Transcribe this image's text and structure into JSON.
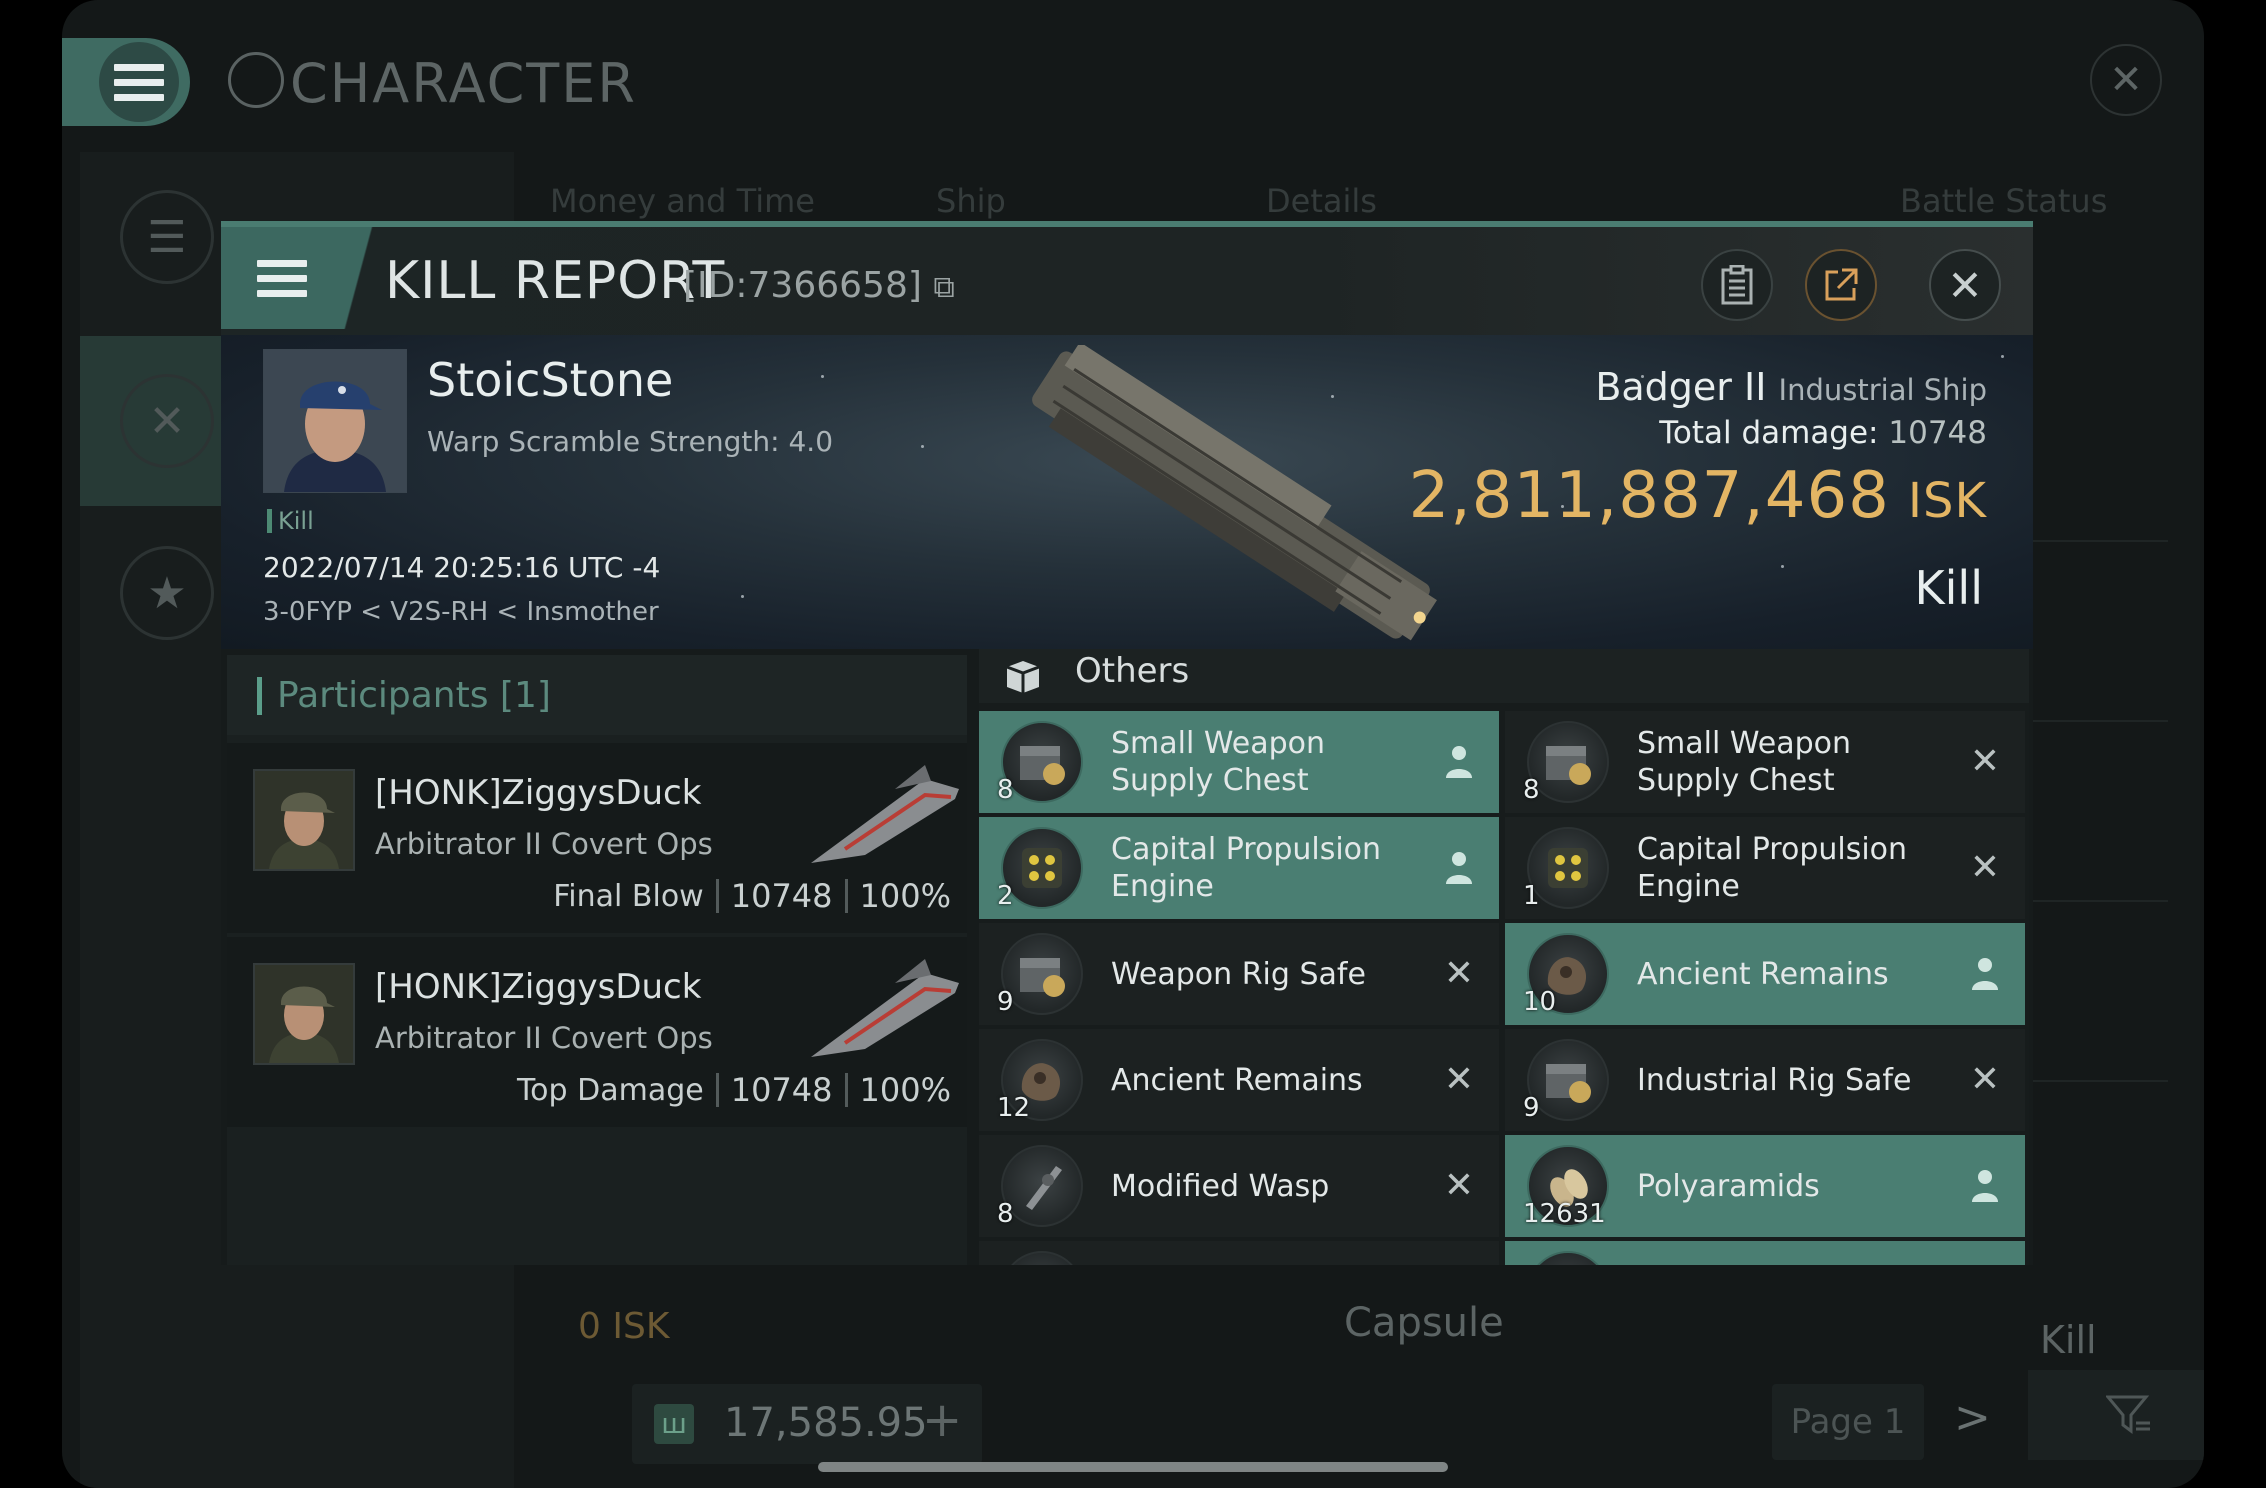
{
  "background_window": {
    "title": "CHARACTER",
    "tabs": [
      "Money and Time",
      "Ship",
      "Details",
      "Battle Status"
    ],
    "bottom_row": {
      "value": "0 ISK",
      "ship": "Capsule",
      "result": "Kill"
    },
    "wallet": {
      "value": "17,585.95",
      "add_label": "+"
    },
    "pagination": {
      "page_label": "Page 1",
      "next_label": ">"
    }
  },
  "kill_report": {
    "title": "KILL REPORT",
    "id_label": "[ID:7366658]",
    "victim": {
      "name": "StoicStone",
      "warp_scramble": "Warp Scramble Strength: 4.0",
      "tag": "Kill",
      "datetime": "2022/07/14 20:25:16 UTC -4",
      "location": "3-0FYP < V2S-RH < Insmother",
      "ship_name": "Badger II",
      "ship_class": "Industrial Ship",
      "total_damage_label": "Total damage:",
      "total_damage": "10748",
      "isk_value": "2,811,887,468",
      "isk_unit": "ISK",
      "result": "Kill"
    },
    "participants": {
      "title": "Participants [1]",
      "rows": [
        {
          "name": "[HONK]ZiggysDuck",
          "ship": "Arbitrator II Covert Ops",
          "label": "Final Blow",
          "damage": "10748",
          "percent": "100%"
        },
        {
          "name": "[HONK]ZiggysDuck",
          "ship": "Arbitrator II Covert Ops",
          "label": "Top Damage",
          "damage": "10748",
          "percent": "100%"
        }
      ]
    },
    "items": {
      "section_title": "Others",
      "cells": [
        {
          "name": "Small Weapon Supply Chest",
          "qty": "8",
          "status": "dropped"
        },
        {
          "name": "Small Weapon Supply Chest",
          "qty": "8",
          "status": "destroyed"
        },
        {
          "name": "Capital Propulsion Engine",
          "qty": "2",
          "status": "dropped"
        },
        {
          "name": "Capital Propulsion Engine",
          "qty": "1",
          "status": "destroyed"
        },
        {
          "name": "Weapon Rig Safe",
          "qty": "9",
          "status": "destroyed"
        },
        {
          "name": "Ancient Remains",
          "qty": "10",
          "status": "dropped"
        },
        {
          "name": "Ancient Remains",
          "qty": "12",
          "status": "destroyed"
        },
        {
          "name": "Industrial Rig Safe",
          "qty": "9",
          "status": "destroyed"
        },
        {
          "name": "Modified Wasp",
          "qty": "8",
          "status": "destroyed"
        },
        {
          "name": "Polyaramids",
          "qty": "12631",
          "status": "dropped"
        }
      ]
    }
  },
  "colors": {
    "accent_green": "#4a7e72",
    "isk_gold": "#e3b564",
    "background": "#141818"
  },
  "icons": {
    "menu": "hamburger-icon",
    "close": "close-icon",
    "copy": "copy-icon",
    "clipboard": "clipboard-icon",
    "share": "external-link-icon",
    "dropped": "person-icon",
    "destroyed": "x-icon"
  }
}
